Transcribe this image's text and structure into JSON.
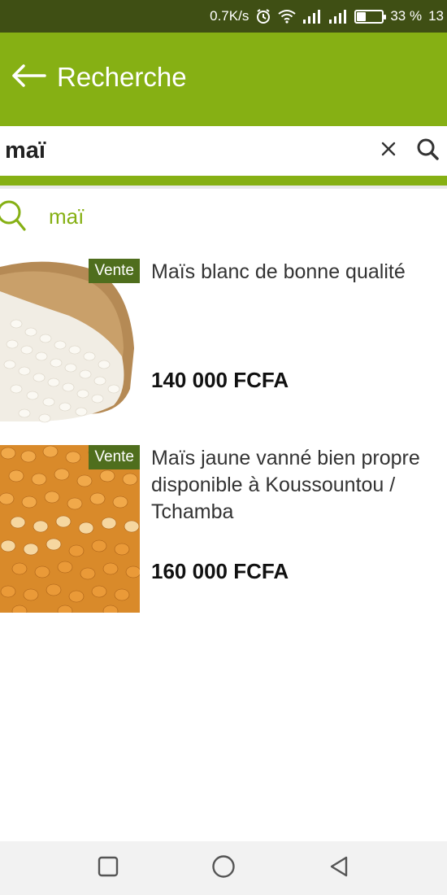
{
  "status_bar": {
    "speed": "0.7K/s",
    "battery_percent": "33 %",
    "time": "13",
    "battery_level": 0.33,
    "background_color": "#3f4f14"
  },
  "app_bar": {
    "title": "Recherche",
    "background_color": "#86b014"
  },
  "search": {
    "query": "maï"
  },
  "suggestion": {
    "text": "maï"
  },
  "listings": [
    {
      "badge": "Vente",
      "title": "Maïs blanc de bonne qualité",
      "price": "140 000 FCFA"
    },
    {
      "badge": "Vente",
      "title": "Maïs jaune vanné bien propre disponible à Koussountou / Tchamba",
      "price": "160 000 FCFA"
    }
  ],
  "colors": {
    "accent": "#86b014",
    "badge": "#4f6e1d"
  }
}
